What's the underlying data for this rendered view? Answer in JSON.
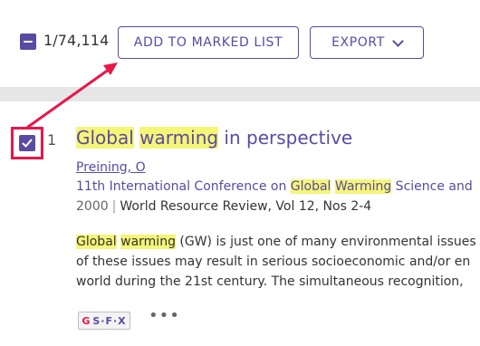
{
  "toolbar": {
    "count": "1/74,114",
    "add_to_marked_list": "ADD TO MARKED LIST",
    "export": "EXPORT"
  },
  "result": {
    "index": "1",
    "title_parts": [
      "Global",
      " ",
      "warming",
      " in perspective"
    ],
    "author": "Preining, O",
    "conference_parts": [
      "11th International Conference on ",
      "Global",
      " ",
      "Warming",
      " Science and"
    ],
    "year": "2000",
    "source": "World Resource Review, Vol 12, Nos 2-4",
    "abstract_lines": [
      [
        "Global",
        " ",
        "warming",
        " (GW) is just one of many environmental issues"
      ],
      [
        "of these issues may result in serious socioeconomic and/or en"
      ],
      [
        "world during the 21st century. The simultaneous recognition,"
      ]
    ],
    "sfx_label": "S·F·X",
    "more_label": "•••"
  },
  "colors": {
    "brand_purple": "#5a4aa3",
    "highlight_yellow": "#f5f578",
    "annotation_red": "#e8164a",
    "toolbar_band": "#e6e6e6"
  },
  "icons": {
    "select_all": "minus-square-icon",
    "checkbox": "checkmark-icon",
    "export_chevron": "chevron-down-icon",
    "more": "ellipsis-icon"
  }
}
